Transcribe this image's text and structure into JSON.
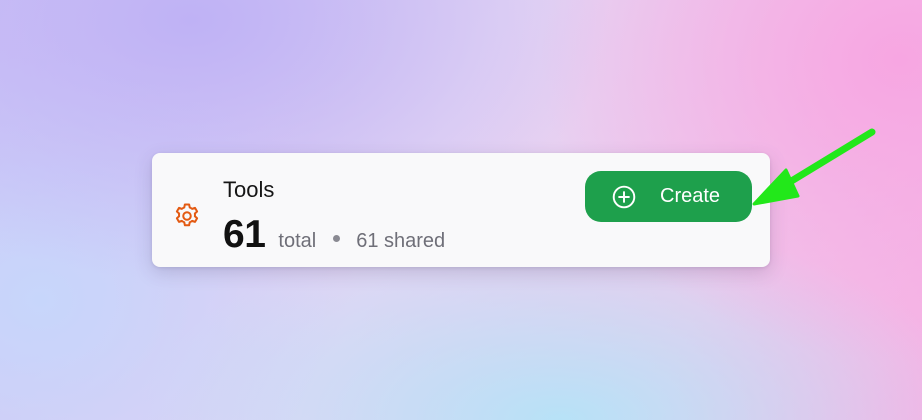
{
  "card": {
    "title": "Tools",
    "total_count": "61",
    "total_label": "total",
    "shared_label": "61 shared"
  },
  "create_button": {
    "label": "Create"
  },
  "icons": {
    "card_icon": "gear-icon",
    "button_icon": "plus-circle-icon",
    "annotation": "arrow-icon"
  },
  "colors": {
    "accent_orange": "#e35a12",
    "button_green": "#1ea04c",
    "arrow_green": "#22e81a"
  }
}
